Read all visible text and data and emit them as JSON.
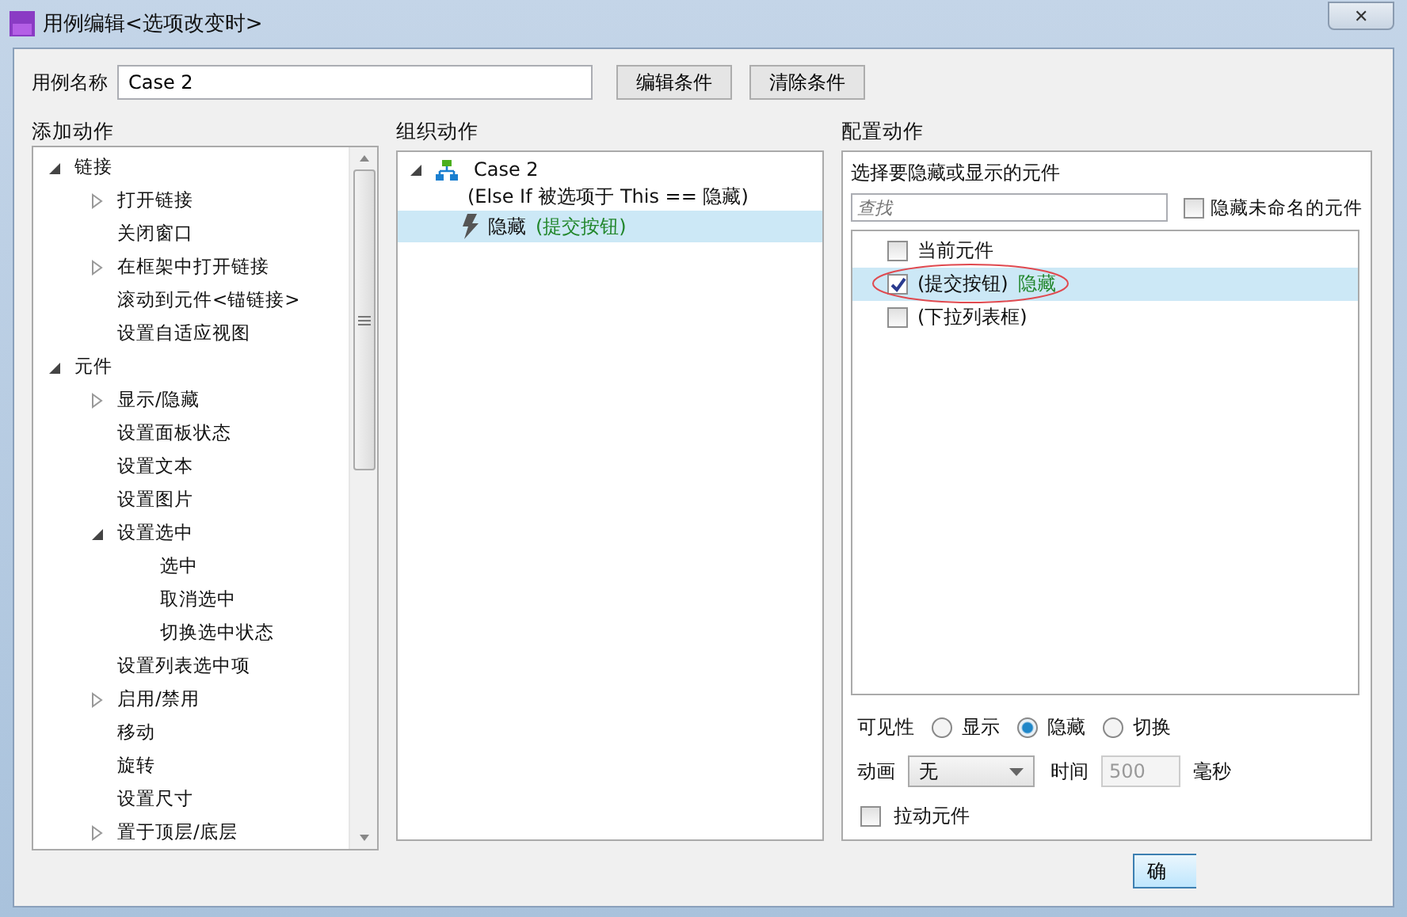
{
  "window": {
    "title": "用例编辑<选项改变时>",
    "close": "✕"
  },
  "case_name": {
    "label": "用例名称",
    "value": "Case 2"
  },
  "buttons": [
    "编辑条件",
    "清除条件"
  ],
  "add_actions": {
    "heading": "添加动作",
    "tree": [
      {
        "label": "链接",
        "expanded": true,
        "children": [
          {
            "label": "打开链接",
            "expanded": false
          },
          {
            "label": "关闭窗口"
          },
          {
            "label": "在框架中打开链接",
            "expanded": false
          },
          {
            "label": "滚动到元件<锚链接>"
          },
          {
            "label": "设置自适应视图"
          }
        ]
      },
      {
        "label": "元件",
        "expanded": true,
        "children": [
          {
            "label": "显示/隐藏",
            "expanded": false
          },
          {
            "label": "设置面板状态"
          },
          {
            "label": "设置文本"
          },
          {
            "label": "设置图片"
          },
          {
            "label": "设置选中",
            "expanded": true,
            "children": [
              {
                "label": "选中"
              },
              {
                "label": "取消选中"
              },
              {
                "label": "切换选中状态"
              }
            ]
          },
          {
            "label": "设置列表选中项"
          },
          {
            "label": "启用/禁用",
            "expanded": false
          },
          {
            "label": "移动"
          },
          {
            "label": "旋转"
          },
          {
            "label": "设置尺寸"
          },
          {
            "label": "置于顶层/底层",
            "expanded": false
          }
        ]
      }
    ]
  },
  "organize_actions": {
    "heading": "组织动作",
    "case": {
      "name": "Case 2",
      "condition": "(Else If 被选项于 This == 隐藏)",
      "expanded": true,
      "actions": [
        {
          "verb": "隐藏",
          "target": "(提交按钮)",
          "selected": true
        }
      ]
    }
  },
  "configure_actions": {
    "heading": "配置动作",
    "prompt": "选择要隐藏或显示的元件",
    "search": {
      "placeholder": "查找"
    },
    "hide_unnamed": {
      "label": "隐藏未命名的元件",
      "checked": false
    },
    "widgets": [
      {
        "label": "当前元件",
        "checked": false,
        "selected": false,
        "circled": false
      },
      {
        "label": "(提交按钮)",
        "status": "隐藏",
        "checked": true,
        "selected": true,
        "circled": true
      },
      {
        "label": "(下拉列表框)",
        "checked": false,
        "selected": false,
        "circled": false
      }
    ],
    "visibility": {
      "label": "可见性",
      "options": [
        {
          "label": "显示",
          "selected": false
        },
        {
          "label": "隐藏",
          "selected": true
        },
        {
          "label": "切换",
          "selected": false
        }
      ]
    },
    "animation": {
      "label": "动画",
      "value": "无"
    },
    "duration": {
      "label": "时间",
      "value": "500",
      "unit": "毫秒",
      "disabled": true
    },
    "drag_widget": {
      "label": "拉动元件",
      "checked": false
    }
  },
  "footer": {
    "ok": "确"
  }
}
